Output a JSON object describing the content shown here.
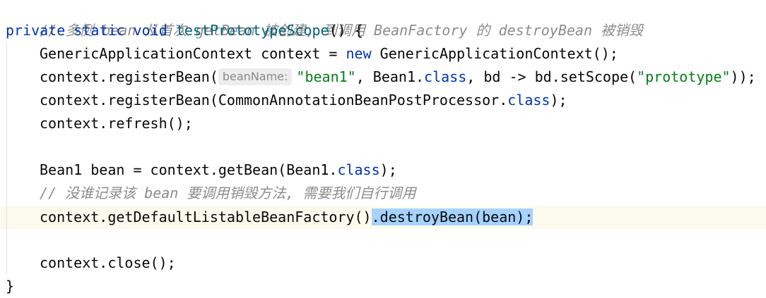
{
  "code": {
    "comment_top": "// 多例 bean 从首次 getBean 被创建, 到调用 BeanFactory 的 destroyBean 被销毁",
    "kw_private_static_void": "private static void ",
    "method_name": "testPrototypeScope",
    "method_tail": "() {",
    "l3_a": "GenericApplicationContext context = ",
    "kw_new": "new",
    "l3_b": " GenericApplicationContext();",
    "l4_a": "context.registerBean(",
    "l4_hint": "beanName:",
    "l4_str1": "\"bean1\"",
    "l4_b": ", Bean1.",
    "kw_class": "class",
    "l4_c": ", bd -> bd.setScope(",
    "l4_str2": "\"prototype\"",
    "l4_d": "));",
    "l5_a": "context.registerBean(CommonAnnotationBeanPostProcessor.",
    "l5_b": ");",
    "l6": "context.refresh();",
    "l8_a": "Bean1 bean = context.getBean(Bean1.",
    "l8_b": ");",
    "comment_mid": "// 没谁记录该 bean 要调用销毁方法, 需要我们自行调用",
    "l10_a": "context.getDefaultListableBeanFactory()",
    "l10_sel": ".destroyBean(bean);",
    "l12": "context.close();",
    "close_brace": "}"
  },
  "colors": {
    "keyword": "#0033b3",
    "method": "#00627a",
    "string": "#067d17",
    "comment": "#8c8c8c",
    "selection": "#a6d2ff"
  }
}
